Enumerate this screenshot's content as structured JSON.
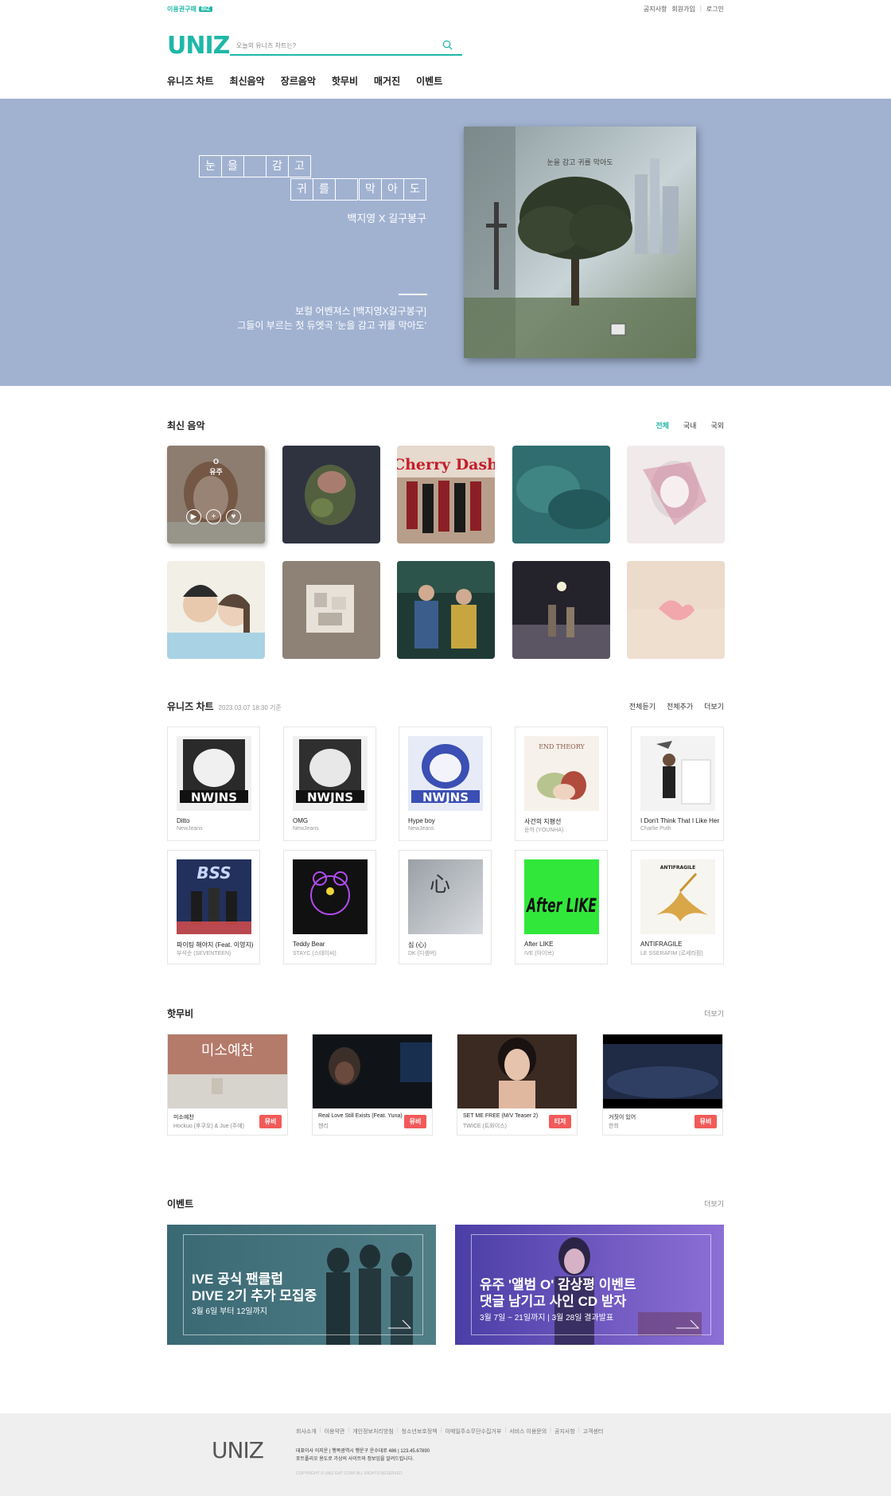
{
  "util": {
    "left_text": "이용권구매",
    "left_badge": "BIZ",
    "links": [
      "공지사항",
      "회원가입",
      "로그인"
    ]
  },
  "header": {
    "logo": "UNIZ",
    "search_placeholder": "오늘의 유니즈 차트는?",
    "nav": [
      "유니즈 차트",
      "최신음악",
      "장르음악",
      "핫무비",
      "매거진",
      "이벤트"
    ]
  },
  "hero": {
    "title_row1": [
      "눈",
      "을",
      "",
      "감",
      "고",
      ""
    ],
    "title_row2": [
      "귀",
      "를",
      "",
      "막",
      "아",
      "도"
    ],
    "artist": "백지영 X 길구봉구",
    "desc1": "보컬 어벤져스 [백지영X길구봉구]",
    "desc2": "그들이 부르는 첫 듀엣곡 '눈을 감고 귀를 막아도'",
    "cover_text": "눈을 감고 귀를 막아도"
  },
  "new_music": {
    "title": "최신 음악",
    "filters": [
      "전체",
      "국내",
      "국외"
    ],
    "active_filter": "전체",
    "hover_label": "유주",
    "cover_texts": [
      "Cherry Dash"
    ],
    "colors": [
      "#c9a58b",
      "#2f3340",
      "#c79a86",
      "#2f6d70",
      "#ece4e4",
      "#f1efe6",
      "#8e8276",
      "#2f3c3a",
      "#3a3a48",
      "#efdfcf"
    ]
  },
  "chart": {
    "title": "유니즈 차트",
    "timestamp": "2023.03.07 18:30 기준",
    "actions": [
      "전체듣기",
      "전체추가",
      "더보기"
    ],
    "items": [
      {
        "title": "Ditto",
        "artist": "NewJeans",
        "cover_text": "NWJNS"
      },
      {
        "title": "OMG",
        "artist": "NewJeans",
        "cover_text": "NWJNS"
      },
      {
        "title": "Hype boy",
        "artist": "NewJeans",
        "cover_text": "NWJNS"
      },
      {
        "title": "사건의 지평선",
        "artist": "윤하 (YOUNHA)",
        "cover_text": "END THEORY"
      },
      {
        "title": "I Don't Think That I Like Her",
        "artist": "Charlie Puth",
        "cover_text": ""
      },
      {
        "title": "파이팅 해야지 (Feat. 이영지)",
        "artist": "부석순 (SEVENTEEN)",
        "cover_text": "BSS"
      },
      {
        "title": "Teddy Bear",
        "artist": "STAYC (스테이씨)",
        "cover_text": ""
      },
      {
        "title": "심 (心)",
        "artist": "DK (디셈버)",
        "cover_text": "心"
      },
      {
        "title": "After LIKE",
        "artist": "IVE (아이브)",
        "cover_text": "After LIKE"
      },
      {
        "title": "ANTIFRAGILE",
        "artist": "LE SSERAFIM (르세라핌)",
        "cover_text": "ANTIFRAGILE"
      }
    ]
  },
  "hot_movie": {
    "title": "핫무비",
    "more": "더보기",
    "items": [
      {
        "title": "미소예찬",
        "artist": "Hockuo (후쿠오) & Jue (주에)",
        "badge": "뮤비",
        "thumb_text": "미소예찬"
      },
      {
        "title": "Real Love Still Exists (Feat. Yuna)",
        "artist": "헨리",
        "badge": "뮤비",
        "thumb_text": ""
      },
      {
        "title": "SET ME FREE (M/V Teaser 2)",
        "artist": "TWICE (트와이스)",
        "badge": "티저",
        "thumb_text": ""
      },
      {
        "title": "거짓이 있어",
        "artist": "한희",
        "badge": "뮤비",
        "thumb_text": ""
      }
    ]
  },
  "events": {
    "title": "이벤트",
    "more": "더보기",
    "items": [
      {
        "line1": "IVE 공식 팬클럽",
        "line2": "DIVE 2기 추가 모집중",
        "line3": "3월 6일 부터 12일까지"
      },
      {
        "line1": "유주 '앨범 O' 감상평 이벤트",
        "line2": "댓글 남기고 사인 CD 받자",
        "line3": "3월 7일 ~ 21일까지 | 3월 28일 결과발표"
      }
    ]
  },
  "footer": {
    "logo": "UNIZ",
    "links": [
      "회사소개",
      "이용약관",
      "개인정보처리방침",
      "청소년보호정책",
      "이메일주소무단수집거부",
      "서비스 이용문의",
      "공지사항",
      "고객센터"
    ],
    "info1": "대표이사 이지운 | 행복광역시 행운구 운수대로 486 | 123.45.67890",
    "info2": "포트폴리오 용도로 가상의 사이트와 정보임을 알려드립니다.",
    "copyright": "COPYRIGHT © UNIZ ENT CORP ALL RIGHTS RESERVED"
  },
  "colors": {
    "accent": "#1fb8a8",
    "hero_bg": "#a1b2d1",
    "badge": "#f25a5a",
    "footer_bg": "#efefef"
  }
}
